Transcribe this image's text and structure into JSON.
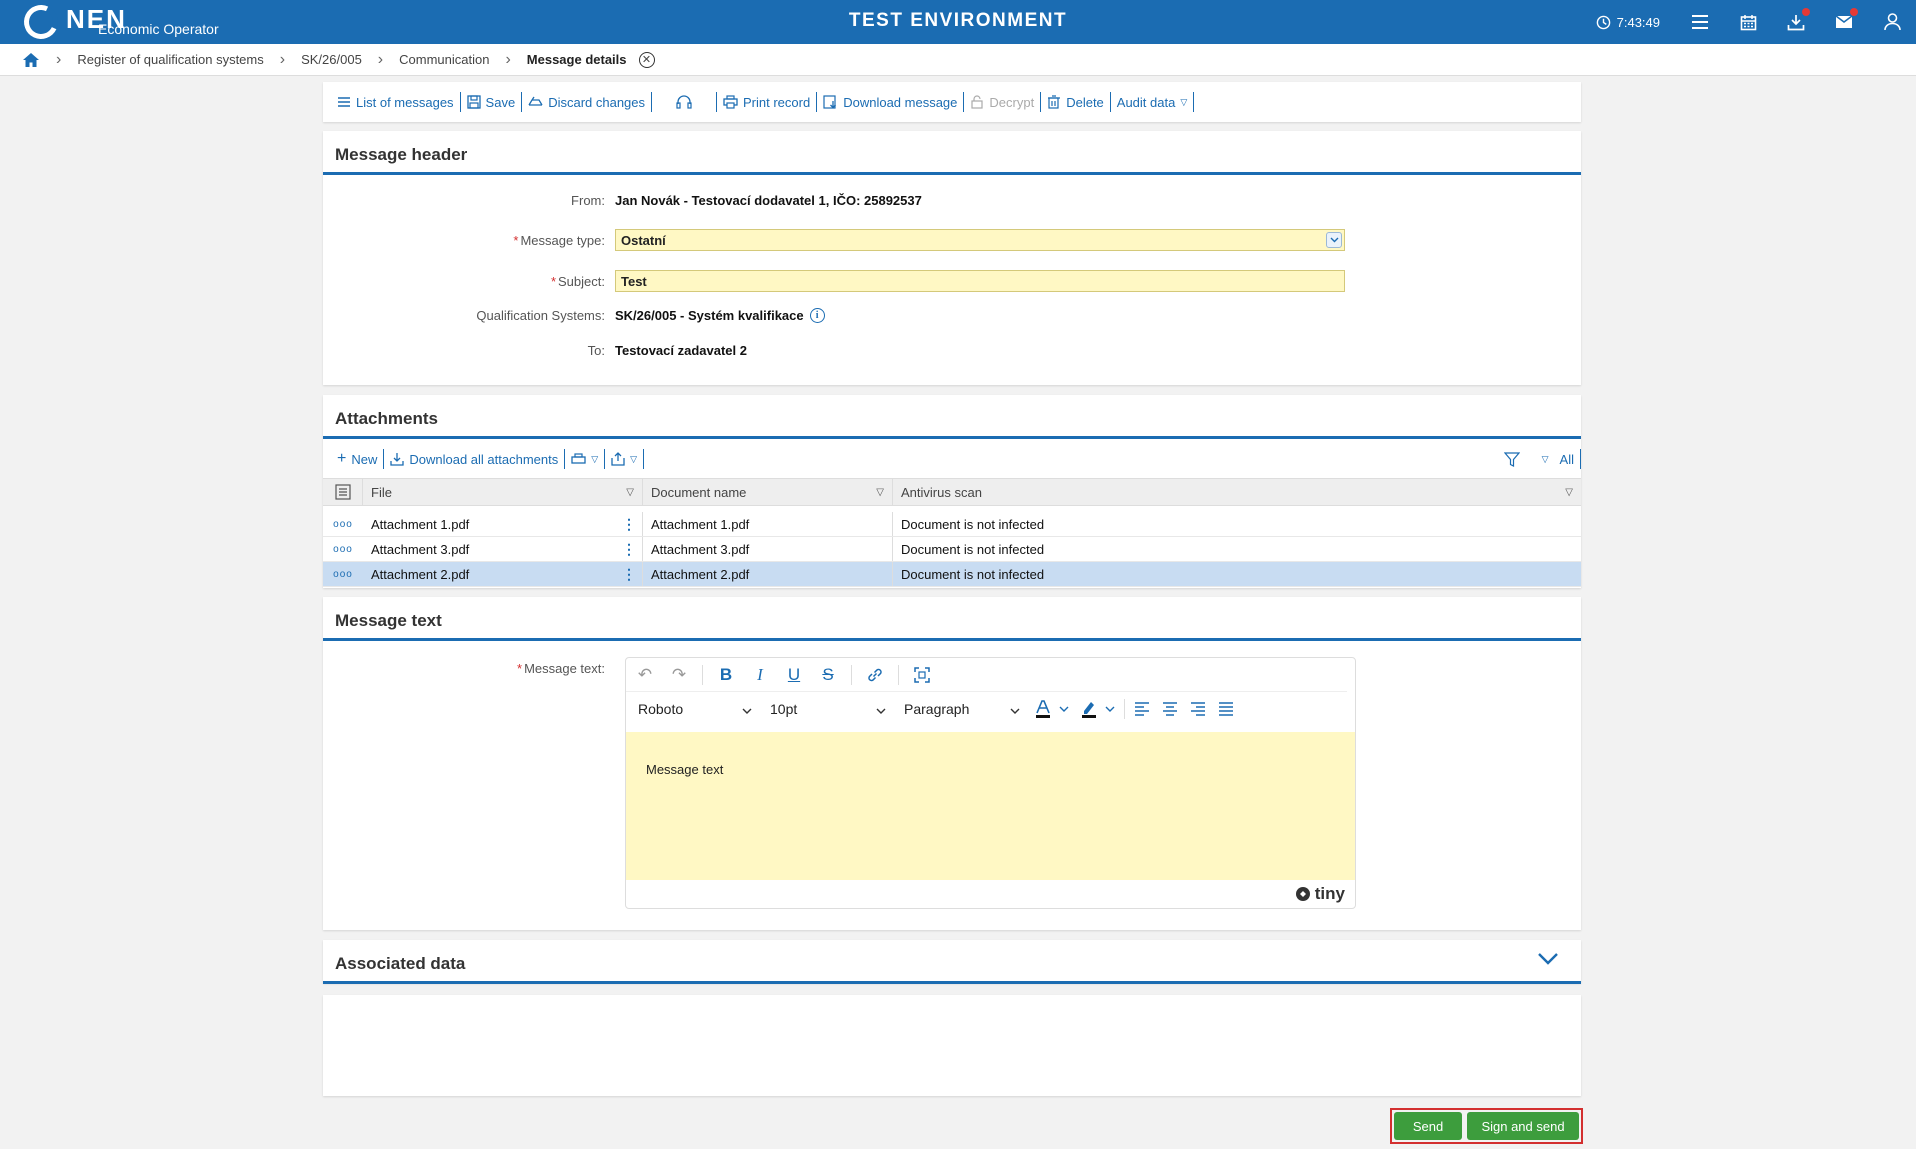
{
  "header": {
    "logo": "NEN",
    "role": "Economic Operator",
    "environment": "TEST ENVIRONMENT",
    "time": "7:43:49"
  },
  "breadcrumb": {
    "items": [
      "Register of qualification systems",
      "SK/26/005",
      "Communication"
    ],
    "current": "Message details"
  },
  "toolbar": {
    "list": "List of messages",
    "save": "Save",
    "discard": "Discard changes",
    "print": "Print record",
    "download": "Download message",
    "decrypt": "Decrypt",
    "delete": "Delete",
    "audit": "Audit data"
  },
  "message_header": {
    "title": "Message header",
    "from_label": "From:",
    "from_value": "Jan Novák - Testovací dodavatel 1, IČO: 25892537",
    "type_label": "Message type:",
    "type_value": "Ostatní",
    "subject_label": "Subject:",
    "subject_value": "Test",
    "qs_label": "Qualification Systems:",
    "qs_value": "SK/26/005 - Systém kvalifikace",
    "to_label": "To:",
    "to_value": "Testovací zadavatel 2"
  },
  "attachments": {
    "title": "Attachments",
    "new": "New",
    "download_all": "Download all attachments",
    "filter_all": "All",
    "columns": [
      "File",
      "Document name",
      "Antivirus scan"
    ],
    "rows": [
      {
        "file": "Attachment 1.pdf",
        "name": "Attachment 1.pdf",
        "scan": "Document is not infected"
      },
      {
        "file": "Attachment 3.pdf",
        "name": "Attachment 3.pdf",
        "scan": "Document is not infected"
      },
      {
        "file": "Attachment 2.pdf",
        "name": "Attachment 2.pdf",
        "scan": "Document is not infected"
      }
    ]
  },
  "message_text": {
    "title": "Message text",
    "label": "Message text:",
    "font": "Roboto",
    "size": "10pt",
    "block": "Paragraph",
    "content": "Message text",
    "brand": "tiny"
  },
  "associated": {
    "title": "Associated data"
  },
  "actions": {
    "send": "Send",
    "sign_send": "Sign and send"
  },
  "colors": {
    "primary": "#1b6cb2",
    "field": "#fff8c4",
    "button": "#3d9d3d",
    "selected_row": "#c8dcf2"
  }
}
